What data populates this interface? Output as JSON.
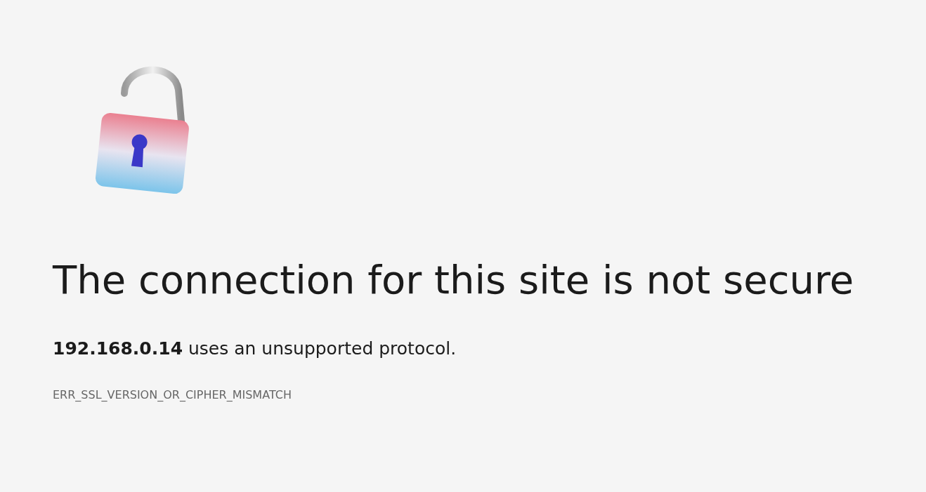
{
  "error_page": {
    "heading": "The connection for this site is not secure",
    "message": "**192.168.0.14** uses an unsupported protocol.",
    "error_code": "ERR_SSL_VERSION_OR_CIPHER_MISMATCH"
  }
}
